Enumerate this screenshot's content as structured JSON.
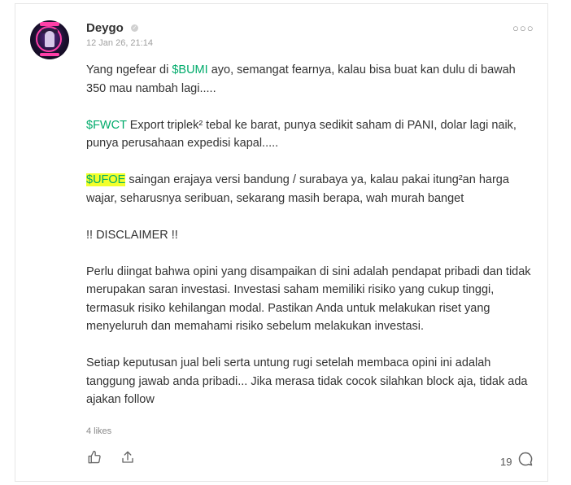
{
  "post": {
    "username": "Deygo",
    "timestamp": "12 Jan 26, 21:14",
    "more_label": "○○○",
    "paragraphs": [
      {
        "pre": "Yang ngefear di ",
        "tag": "$BUMI",
        "post": " ayo, semangat fearnya, kalau bisa buat kan dulu di bawah 350 mau nambah lagi....."
      },
      {
        "pre": "",
        "tag": "$FWCT",
        "post": " Export triplek² tebal ke barat, punya sedikit saham di PANI, dolar lagi naik, punya perusahaan expedisi kapal....."
      },
      {
        "pre": "",
        "tag": "$UFOE",
        "post": " saingan erajaya versi bandung / surabaya ya, kalau pakai itung²an harga wajar, seharusnya seribuan, sekarang masih berapa, wah murah banget"
      },
      {
        "text": "!! DISCLAIMER !!"
      },
      {
        "text": "Perlu diingat bahwa opini yang disampaikan di sini adalah pendapat pribadi dan tidak merupakan saran investasi. Investasi saham memiliki risiko yang cukup tinggi, termasuk risiko kehilangan modal. Pastikan Anda untuk melakukan riset yang menyeluruh dan memahami risiko sebelum melakukan investasi."
      },
      {
        "text": "Setiap keputusan jual beli serta untung rugi setelah membaca opini ini adalah tanggung jawab anda pribadi... Jika merasa tidak cocok silahkan block aja, tidak ada ajakan follow"
      }
    ],
    "likes": "4 likes",
    "comment_count": "19"
  },
  "icons": {
    "like": "thumbs-up-icon",
    "share": "share-icon",
    "comment": "comment-bubble-icon",
    "more": "more-options-icon",
    "verified": "verified-badge-icon"
  },
  "colors": {
    "cashtag": "#00ab6b",
    "highlight": "#f2ff2b"
  }
}
